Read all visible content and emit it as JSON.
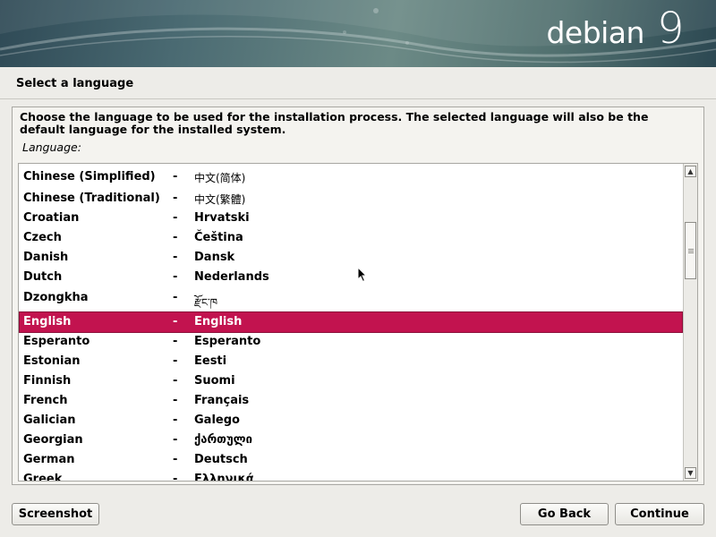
{
  "banner": {
    "brand_name": "debian",
    "brand_version": "9"
  },
  "page_title": "Select a language",
  "description": "Choose the language to be used for the installation process. The selected language will also be the default language for the installed system.",
  "field_label": "Language:",
  "separator": "-",
  "languages": [
    {
      "name": "Chinese (Simplified)",
      "native": "中文(简体)",
      "selected": false
    },
    {
      "name": "Chinese (Traditional)",
      "native": "中文(繁體)",
      "selected": false
    },
    {
      "name": "Croatian",
      "native": "Hrvatski",
      "selected": false
    },
    {
      "name": "Czech",
      "native": "Čeština",
      "selected": false
    },
    {
      "name": "Danish",
      "native": "Dansk",
      "selected": false
    },
    {
      "name": "Dutch",
      "native": "Nederlands",
      "selected": false
    },
    {
      "name": "Dzongkha",
      "native": "རྫོང་ཁ",
      "selected": false
    },
    {
      "name": "English",
      "native": "English",
      "selected": true
    },
    {
      "name": "Esperanto",
      "native": "Esperanto",
      "selected": false
    },
    {
      "name": "Estonian",
      "native": "Eesti",
      "selected": false
    },
    {
      "name": "Finnish",
      "native": "Suomi",
      "selected": false
    },
    {
      "name": "French",
      "native": "Français",
      "selected": false
    },
    {
      "name": "Galician",
      "native": "Galego",
      "selected": false
    },
    {
      "name": "Georgian",
      "native": "ქართული",
      "selected": false
    },
    {
      "name": "German",
      "native": "Deutsch",
      "selected": false
    },
    {
      "name": "Greek",
      "native": "Ελληνικά",
      "selected": false
    }
  ],
  "buttons": {
    "screenshot": "Screenshot",
    "go_back": "Go Back",
    "continue": "Continue"
  },
  "colors": {
    "selection": "#c2134f",
    "background": "#edece8"
  }
}
